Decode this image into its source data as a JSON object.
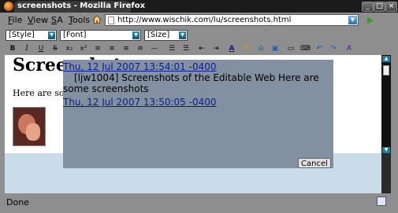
{
  "window": {
    "title": "screenshots - Mozilla Firefox",
    "minimize_glyph": "_",
    "maximize_glyph": "□",
    "close_glyph": "×"
  },
  "menu": {
    "file": "ile",
    "file_accel": "F",
    "view": "iew",
    "view_accel": "V",
    "sa": "A",
    "sa_accel": "S",
    "tools": "ools",
    "tools_accel": "T"
  },
  "address": {
    "url": "http://www.wischik.com/lu/screenshots.html",
    "go_glyph": "▶"
  },
  "format": {
    "style": "[Style]",
    "font": "[Font]",
    "size": "[Size]",
    "bold": "B",
    "italic": "I",
    "underline": "U",
    "strike": "S"
  },
  "document": {
    "heading": "Screenshots",
    "paragraph": "Here are some screenshots"
  },
  "overlay": {
    "link1": "Thu, 12 Jul 2007 13:54:01 -0400",
    "body": "[ljw1004] Screenshots of the Editable Web Here are some screenshots",
    "link2": "Thu, 12 Jul 2007 13:50:05 -0400",
    "cancel": "Cancel"
  },
  "status": {
    "text": "Done"
  },
  "icons": {
    "home": "home-icon",
    "page": "page-icon",
    "go": "go-arrow-icon",
    "app": "firefox-icon"
  }
}
